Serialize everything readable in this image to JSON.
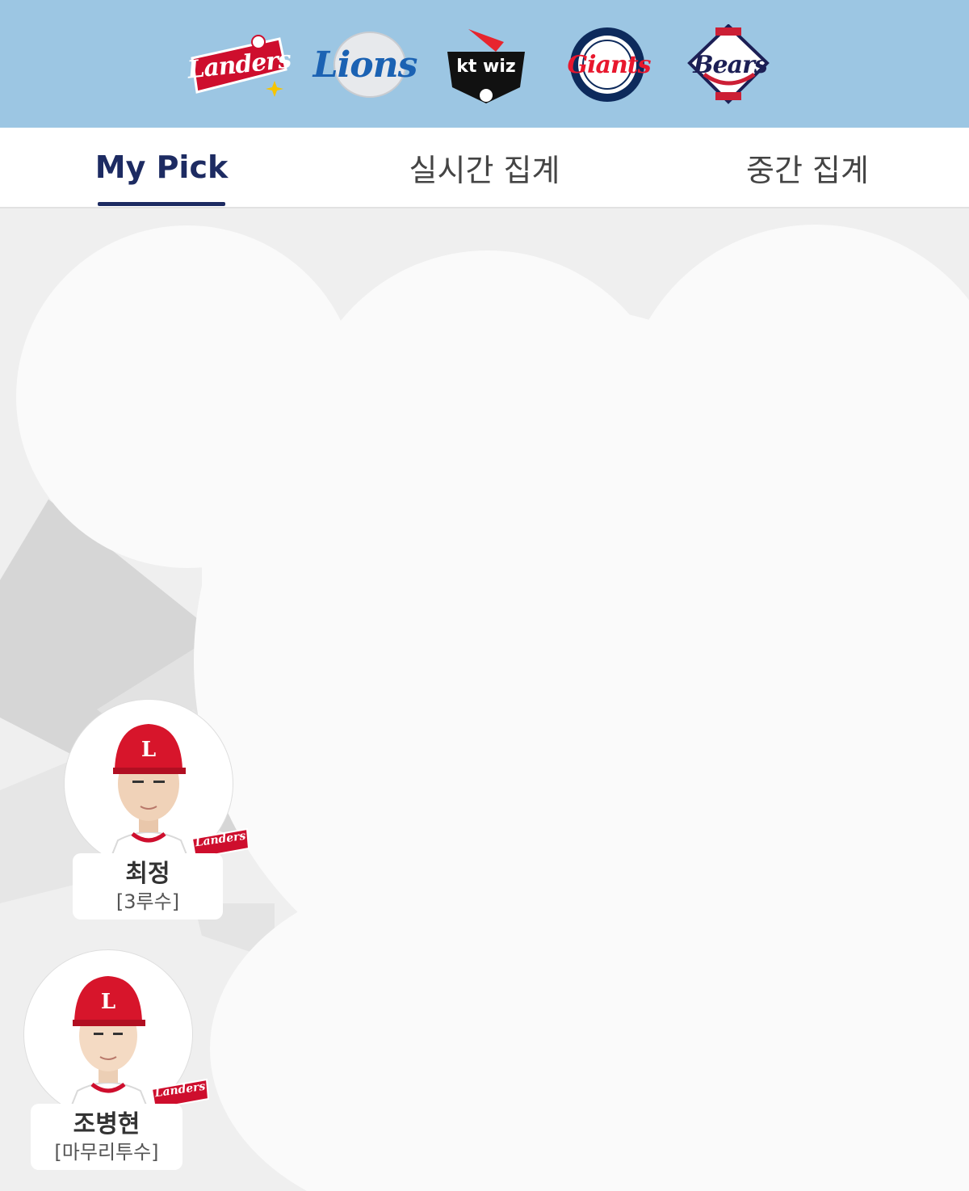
{
  "teams": [
    {
      "id": "landers",
      "logo_text": "Landers",
      "color": "#ce0e2d"
    },
    {
      "id": "lions",
      "logo_text": "Lions",
      "color": "#1b62b3"
    },
    {
      "id": "ktwiz",
      "logo_text": "kt wiz",
      "color": "#000000"
    },
    {
      "id": "giants",
      "logo_text": "Giants",
      "color": "#e8172d"
    },
    {
      "id": "bears",
      "logo_text": "Bears",
      "color": "#1c1f55"
    }
  ],
  "tabs": {
    "my_pick": "My Pick",
    "realtime": "실시간 집계",
    "interim": "중간 집계",
    "active": "my_pick",
    "active_color": "#1d2b62"
  },
  "players": [
    {
      "name": "최정",
      "position": "[3루수]",
      "team_badge": "Landers"
    },
    {
      "name": "조병현",
      "position": "[마무리투수]",
      "team_badge": "Landers"
    }
  ]
}
